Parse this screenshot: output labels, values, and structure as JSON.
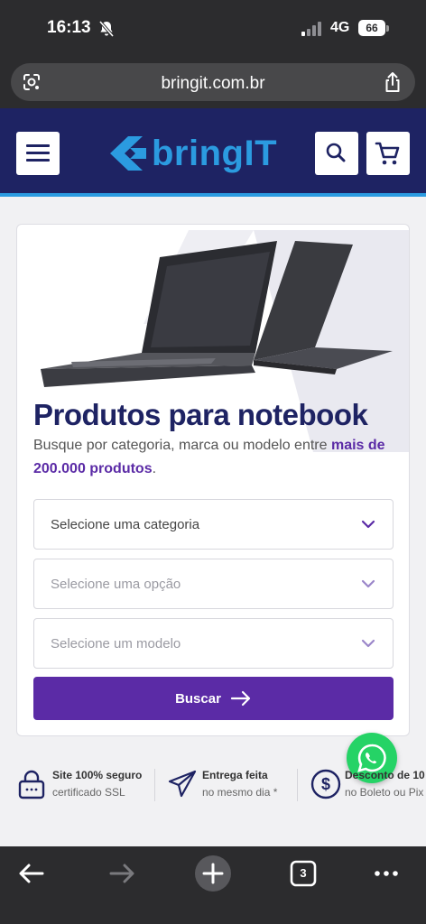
{
  "status": {
    "time": "16:13",
    "network": "4G",
    "battery": "66"
  },
  "browser": {
    "url": "bringit.com.br",
    "tab_count": "3"
  },
  "header": {
    "logo_text": "bringIT",
    "brand_color": "#2b9be0",
    "bg_color": "#1e2363"
  },
  "card": {
    "title": "Produtos para notebook",
    "desc_prefix": "Busque por categoria, marca ou modelo entre ",
    "desc_highlight": "mais de 200.000 produtos",
    "desc_suffix": ".",
    "selects": [
      {
        "label": "Selecione uma categoria"
      },
      {
        "label": "Selecione uma opção"
      },
      {
        "label": "Selecione um modelo"
      }
    ],
    "submit_label": "Buscar",
    "accent_color": "#5b2ba6"
  },
  "features": [
    {
      "title": "Site 100% seguro",
      "subtitle": "certificado SSL",
      "icon": "lock-icon"
    },
    {
      "title": "Entrega feita",
      "subtitle": "no mesmo dia *",
      "icon": "paper-plane-icon"
    },
    {
      "title": "Desconto de 10",
      "subtitle": "no Boleto ou Pix",
      "icon": "dollar-icon"
    }
  ]
}
